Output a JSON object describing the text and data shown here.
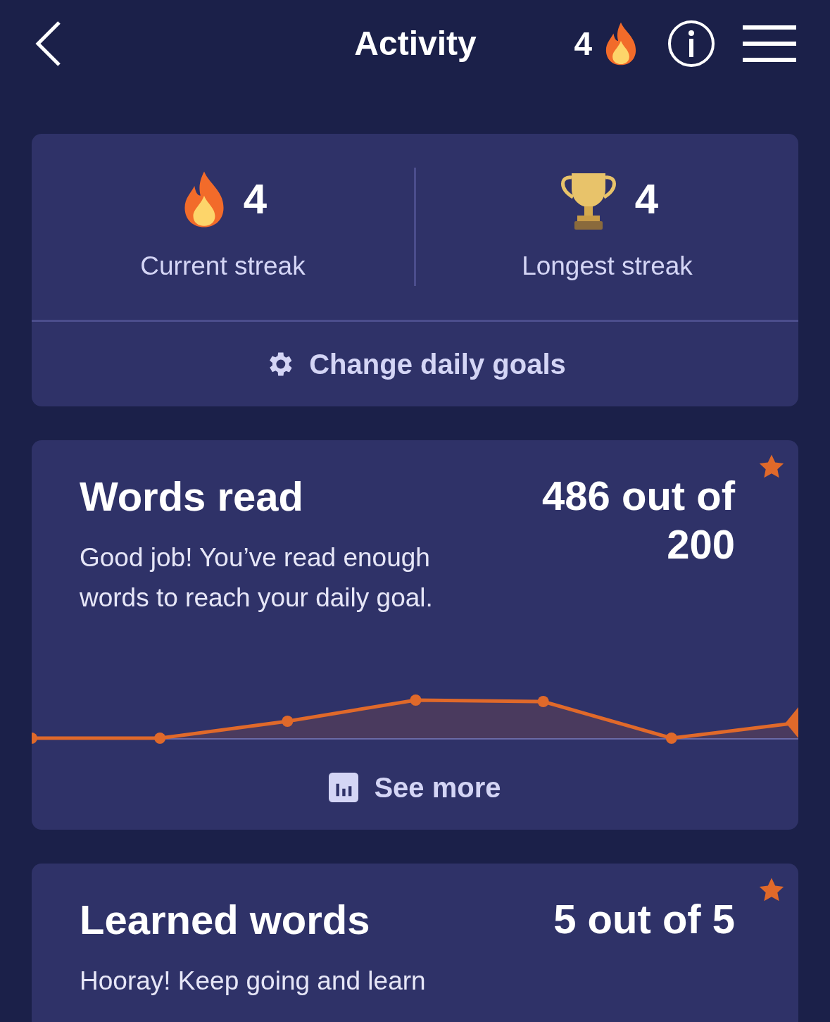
{
  "header": {
    "title": "Activity",
    "streak_count": "4"
  },
  "streaks": [
    {
      "kind": "fire",
      "value": "4",
      "label": "Current streak"
    },
    {
      "kind": "trophy",
      "value": "4",
      "label": "Longest streak"
    }
  ],
  "goals_button": "Change daily goals",
  "goal_cards": [
    {
      "title": "Words read",
      "value": "486 out of 200",
      "description": "Good job! You’ve read enough words to reach your daily goal.",
      "completed": true,
      "kind": "chart",
      "action": "See more"
    },
    {
      "title": "Learned words",
      "value": "5 out of 5",
      "description": "Hooray! Keep going and learn",
      "completed": true,
      "kind": "text"
    }
  ]
}
